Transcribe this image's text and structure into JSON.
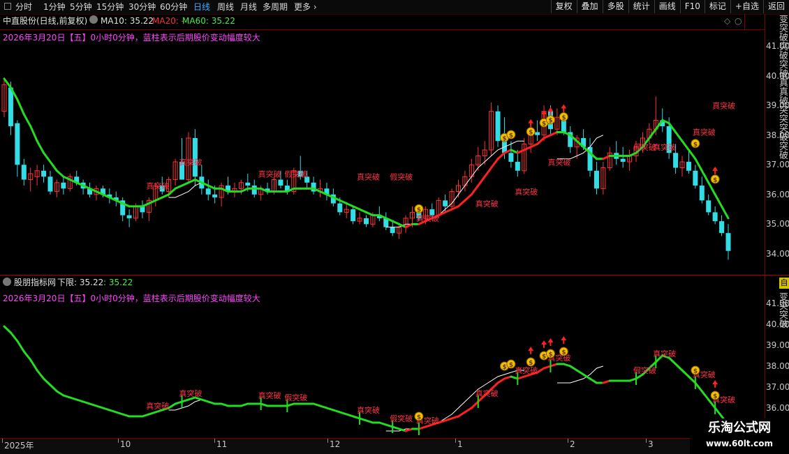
{
  "toolbar": {
    "tabs": [
      {
        "label": "分时",
        "active": false
      },
      {
        "label": "1分钟",
        "active": false
      },
      {
        "label": "5分钟",
        "active": false
      },
      {
        "label": "15分钟",
        "active": false
      },
      {
        "label": "30分钟",
        "active": false
      },
      {
        "label": "60分钟",
        "active": false
      },
      {
        "label": "日线",
        "active": true
      },
      {
        "label": "周线",
        "active": false
      },
      {
        "label": "月线",
        "active": false
      },
      {
        "label": "多周期",
        "active": false
      },
      {
        "label": "更多",
        "active": false
      }
    ],
    "right_buttons": [
      "复权",
      "叠加",
      "多股",
      "统计",
      "画线",
      "F10",
      "标记",
      "+自选",
      "返回"
    ]
  },
  "main_pane": {
    "title": "中直股份(日线,前复权)",
    "ma10_label": "MA10: 35.22",
    "ma20_label": "MA20: -",
    "ma60_label": "MA60: 35.22",
    "info_line": "2026年3月20日【五】0小时0分钟，蓝柱表示后期股价变动幅度较大"
  },
  "sub_pane": {
    "title": "股朋指标网",
    "lower_label": "下限: 35.22",
    "value_label": ": 35.22",
    "info_line": "2026年3月20日【五】0小时0分钟，蓝柱表示后期股价变动幅度较大"
  },
  "axis": {
    "main_ticks": [
      "41.00",
      "40.00",
      "39.00",
      "38.00",
      "37.00",
      "36.00",
      "35.00",
      "34.00"
    ],
    "sub_ticks": [
      "41.00",
      "40.00",
      "39.00",
      "38.00",
      "37.00",
      "36.00"
    ]
  },
  "right_panel_text": "变突破突破突破真真破突突突破突破",
  "right_panel_text2": "变突突破",
  "right_badge": "自",
  "footer": {
    "months": [
      {
        "label": "2025年"
      },
      {
        "label": "10"
      },
      {
        "label": "11"
      },
      {
        "label": "12"
      },
      {
        "label": "1"
      },
      {
        "label": "2"
      },
      {
        "label": "3"
      }
    ]
  },
  "signals": {
    "true_break": "真突破",
    "false_break": "假突破"
  },
  "watermark": {
    "title": "乐淘公式网",
    "url": "www.60lt.com"
  },
  "chart_data": {
    "type": "candlestick",
    "colors": {
      "up": "#ff3333",
      "down": "#33dde6",
      "ma_up": "#ff2020",
      "ma_down": "#22dd22",
      "lower": "#ffffff"
    },
    "price_range": [
      33.6,
      41.4
    ],
    "candles": [
      [
        38.8,
        39.9,
        38.6,
        39.7
      ],
      [
        39.6,
        39.8,
        38.0,
        38.3
      ],
      [
        38.4,
        38.5,
        36.6,
        37.0
      ],
      [
        37.0,
        37.2,
        36.3,
        36.5
      ],
      [
        36.5,
        36.9,
        36.1,
        36.7
      ],
      [
        36.6,
        37.0,
        36.3,
        36.8
      ],
      [
        36.8,
        37.0,
        36.4,
        36.6
      ],
      [
        36.6,
        36.8,
        36.0,
        36.1
      ],
      [
        36.1,
        36.5,
        35.9,
        36.4
      ],
      [
        36.4,
        36.6,
        36.0,
        36.2
      ],
      [
        36.2,
        36.7,
        36.1,
        36.6
      ],
      [
        36.6,
        36.8,
        36.3,
        36.4
      ],
      [
        36.4,
        36.5,
        36.0,
        36.2
      ],
      [
        36.2,
        36.4,
        35.9,
        36.0
      ],
      [
        36.0,
        36.3,
        35.8,
        36.2
      ],
      [
        36.2,
        36.3,
        35.9,
        36.0
      ],
      [
        36.0,
        36.2,
        35.7,
        35.9
      ],
      [
        35.9,
        36.1,
        35.6,
        35.8
      ],
      [
        35.8,
        35.9,
        35.1,
        35.3
      ],
      [
        35.3,
        35.5,
        34.9,
        35.2
      ],
      [
        35.2,
        35.7,
        35.1,
        35.6
      ],
      [
        35.6,
        35.8,
        35.2,
        35.4
      ],
      [
        35.4,
        35.9,
        35.1,
        35.8
      ],
      [
        35.8,
        36.4,
        35.6,
        36.3
      ],
      [
        36.3,
        36.6,
        36.0,
        36.1
      ],
      [
        36.1,
        36.6,
        35.9,
        36.5
      ],
      [
        36.5,
        37.2,
        36.3,
        37.1
      ],
      [
        37.1,
        37.9,
        36.8,
        36.5
      ],
      [
        36.5,
        38.1,
        36.4,
        37.9
      ],
      [
        37.9,
        38.2,
        36.3,
        36.6
      ],
      [
        36.6,
        37.0,
        36.0,
        36.2
      ],
      [
        36.2,
        36.5,
        35.8,
        36.0
      ],
      [
        36.0,
        36.3,
        35.7,
        35.9
      ],
      [
        35.9,
        36.4,
        35.6,
        36.3
      ],
      [
        36.3,
        36.6,
        36.0,
        36.1
      ],
      [
        36.1,
        36.4,
        35.9,
        36.2
      ],
      [
        36.2,
        36.5,
        36.0,
        36.4
      ],
      [
        36.4,
        36.7,
        36.1,
        36.3
      ],
      [
        36.3,
        36.5,
        35.9,
        36.0
      ],
      [
        36.0,
        36.3,
        35.8,
        36.2
      ],
      [
        36.2,
        36.4,
        36.0,
        36.1
      ],
      [
        36.1,
        36.6,
        36.0,
        36.5
      ],
      [
        36.5,
        36.8,
        36.2,
        36.3
      ],
      [
        36.3,
        36.5,
        36.0,
        36.1
      ],
      [
        36.1,
        36.9,
        36.0,
        36.8
      ],
      [
        36.8,
        37.3,
        36.5,
        36.6
      ],
      [
        36.6,
        36.8,
        36.2,
        36.4
      ],
      [
        36.4,
        36.6,
        36.0,
        36.1
      ],
      [
        36.1,
        36.5,
        35.9,
        36.2
      ],
      [
        36.2,
        36.4,
        35.8,
        36.0
      ],
      [
        36.0,
        36.2,
        35.6,
        35.7
      ],
      [
        35.7,
        35.9,
        35.3,
        35.4
      ],
      [
        35.4,
        35.7,
        35.2,
        35.5
      ],
      [
        35.5,
        35.6,
        35.0,
        35.1
      ],
      [
        35.1,
        35.4,
        35.0,
        35.2
      ],
      [
        35.2,
        35.3,
        34.9,
        35.0
      ],
      [
        35.0,
        35.4,
        34.9,
        35.3
      ],
      [
        35.3,
        35.6,
        35.1,
        35.2
      ],
      [
        35.2,
        35.4,
        34.8,
        34.9
      ],
      [
        34.9,
        35.1,
        34.6,
        34.7
      ],
      [
        34.7,
        35.0,
        34.5,
        34.9
      ],
      [
        34.9,
        35.3,
        34.7,
        35.2
      ],
      [
        35.2,
        35.6,
        34.9,
        35.4
      ],
      [
        35.4,
        35.6,
        35.1,
        35.2
      ],
      [
        35.2,
        35.6,
        35.0,
        35.5
      ],
      [
        35.5,
        35.7,
        35.2,
        35.3
      ],
      [
        35.3,
        35.9,
        35.2,
        35.8
      ],
      [
        35.8,
        36.0,
        35.4,
        35.6
      ],
      [
        35.6,
        36.2,
        35.5,
        36.1
      ],
      [
        36.1,
        36.5,
        35.9,
        36.3
      ],
      [
        36.3,
        36.8,
        36.1,
        36.6
      ],
      [
        36.6,
        37.2,
        36.4,
        37.0
      ],
      [
        37.0,
        37.6,
        36.8,
        37.3
      ],
      [
        37.3,
        37.8,
        37.0,
        37.5
      ],
      [
        37.5,
        39.1,
        37.3,
        38.8
      ],
      [
        38.8,
        39.0,
        37.6,
        37.8
      ],
      [
        37.8,
        38.6,
        37.2,
        37.4
      ],
      [
        37.4,
        37.8,
        36.9,
        37.1
      ],
      [
        37.1,
        37.5,
        36.6,
        36.8
      ],
      [
        36.8,
        37.9,
        36.7,
        37.7
      ],
      [
        37.7,
        38.3,
        37.4,
        38.1
      ],
      [
        38.1,
        38.5,
        37.8,
        38.0
      ],
      [
        38.0,
        39.0,
        37.8,
        38.8
      ],
      [
        38.8,
        39.0,
        38.0,
        38.2
      ],
      [
        38.2,
        38.9,
        38.0,
        38.6
      ],
      [
        38.6,
        38.8,
        38.0,
        38.1
      ],
      [
        38.1,
        38.3,
        37.4,
        37.6
      ],
      [
        37.6,
        38.0,
        37.2,
        37.9
      ],
      [
        37.9,
        38.2,
        37.5,
        37.6
      ],
      [
        37.6,
        37.9,
        36.6,
        36.8
      ],
      [
        36.8,
        37.1,
        36.0,
        36.2
      ],
      [
        36.2,
        37.1,
        36.0,
        36.9
      ],
      [
        36.9,
        37.6,
        36.8,
        37.4
      ],
      [
        37.4,
        37.8,
        37.0,
        37.2
      ],
      [
        37.2,
        37.6,
        36.9,
        37.1
      ],
      [
        37.1,
        37.5,
        36.8,
        37.3
      ],
      [
        37.3,
        37.8,
        37.1,
        37.6
      ],
      [
        37.6,
        38.1,
        37.4,
        37.9
      ],
      [
        37.9,
        38.4,
        37.7,
        38.2
      ],
      [
        38.2,
        39.3,
        38.0,
        38.5
      ],
      [
        38.5,
        38.9,
        38.1,
        38.3
      ],
      [
        38.3,
        38.6,
        37.2,
        37.4
      ],
      [
        37.4,
        37.7,
        36.7,
        36.9
      ],
      [
        36.9,
        37.3,
        36.6,
        37.1
      ],
      [
        37.1,
        37.5,
        36.7,
        36.8
      ],
      [
        36.8,
        37.0,
        36.2,
        36.3
      ],
      [
        36.3,
        36.6,
        35.7,
        35.8
      ],
      [
        35.8,
        36.0,
        35.3,
        35.4
      ],
      [
        35.4,
        35.6,
        35.0,
        35.1
      ],
      [
        35.1,
        35.3,
        34.6,
        34.7
      ],
      [
        34.7,
        35.0,
        33.8,
        34.1
      ]
    ],
    "ma_line": [
      39.9,
      39.6,
      39.2,
      38.7,
      38.3,
      37.8,
      37.4,
      37.1,
      36.8,
      36.6,
      36.5,
      36.4,
      36.3,
      36.2,
      36.1,
      36.0,
      35.9,
      35.8,
      35.7,
      35.6,
      35.6,
      35.6,
      35.7,
      35.8,
      35.9,
      36.0,
      36.2,
      36.3,
      36.4,
      36.5,
      36.4,
      36.3,
      36.2,
      36.2,
      36.1,
      36.1,
      36.1,
      36.2,
      36.2,
      36.2,
      36.1,
      36.1,
      36.1,
      36.1,
      36.2,
      36.2,
      36.2,
      36.2,
      36.1,
      36.0,
      35.9,
      35.8,
      35.7,
      35.6,
      35.5,
      35.4,
      35.3,
      35.3,
      35.2,
      35.1,
      35.0,
      34.9,
      35.0,
      35.0,
      35.1,
      35.2,
      35.3,
      35.4,
      35.5,
      35.6,
      35.8,
      36.0,
      36.3,
      36.6,
      36.9,
      37.2,
      37.4,
      37.5,
      37.4,
      37.5,
      37.6,
      37.7,
      37.9,
      38.0,
      38.1,
      38.1,
      38.0,
      37.8,
      37.6,
      37.4,
      37.2,
      37.2,
      37.3,
      37.3,
      37.3,
      37.3,
      37.4,
      37.6,
      37.9,
      38.2,
      38.5,
      38.4,
      38.1,
      37.8,
      37.5,
      37.2,
      36.8,
      36.4,
      36.0,
      35.6,
      35.2
    ],
    "lower_line": [
      null,
      null,
      null,
      null,
      null,
      null,
      null,
      null,
      null,
      null,
      null,
      null,
      null,
      null,
      null,
      null,
      null,
      null,
      null,
      null,
      null,
      null,
      null,
      null,
      null,
      35.9,
      35.9,
      36.0,
      36.1,
      36.3,
      36.4,
      36.3,
      null,
      null,
      null,
      null,
      null,
      null,
      null,
      null,
      null,
      null,
      null,
      null,
      null,
      null,
      null,
      null,
      null,
      null,
      null,
      null,
      null,
      null,
      null,
      null,
      null,
      null,
      34.9,
      34.9,
      34.9,
      35.0,
      35.0,
      35.0,
      35.1,
      35.2,
      35.3,
      35.5,
      35.7,
      36.0,
      36.3,
      36.6,
      36.9,
      37.1,
      37.3,
      37.5,
      37.6,
      37.7,
      37.8,
      37.8,
      null,
      null,
      null,
      null,
      37.2,
      37.2,
      37.2,
      37.3,
      37.4,
      37.6,
      37.9,
      38.0,
      null,
      null,
      null,
      null,
      null,
      null,
      null,
      null,
      null,
      null,
      null,
      null,
      null,
      null,
      null,
      null,
      null,
      null,
      null
    ],
    "annotations": [
      {
        "text": "真突破",
        "index": 27,
        "price": 37.0
      },
      {
        "text": "真突破",
        "index": 22,
        "price": 36.2
      },
      {
        "text": "真突破",
        "index": 39,
        "price": 36.6
      },
      {
        "text": "假突破",
        "index": 43,
        "price": 36.6
      },
      {
        "text": "真突破",
        "index": 54,
        "price": 36.5
      },
      {
        "text": "假突破",
        "index": 59,
        "price": 36.5
      },
      {
        "text": "真突破",
        "index": 63,
        "price": 35.1
      },
      {
        "text": "真突破",
        "index": 72,
        "price": 35.6
      },
      {
        "text": "真突破",
        "index": 78,
        "price": 36.0
      },
      {
        "text": "真突破",
        "index": 83,
        "price": 37.0
      },
      {
        "text": "假突破",
        "index": 96,
        "price": 37.5
      },
      {
        "text": "真突破",
        "index": 99,
        "price": 37.5
      },
      {
        "text": "真突破",
        "index": 105,
        "price": 38.0
      },
      {
        "text": "真突破",
        "index": 108,
        "price": 38.9
      }
    ],
    "money_bags": [
      63,
      76,
      77,
      80,
      82,
      83,
      85,
      105,
      108
    ],
    "arrows": [
      80,
      82,
      83,
      85,
      108
    ]
  }
}
